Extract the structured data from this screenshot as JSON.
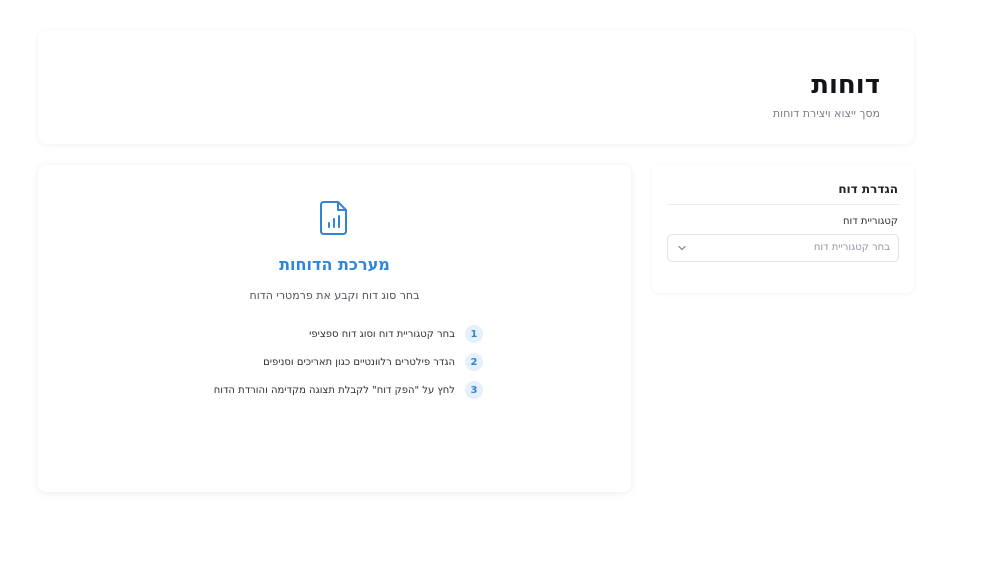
{
  "header": {
    "title": "דוחות",
    "subtitle": "מסך ייצוא ויצירת דוחות"
  },
  "setup": {
    "title": "הגדרת דוח",
    "category_label": "קטגוריית דוח",
    "category_placeholder": "בחר קטגוריית דוח",
    "chevron_icon": "chevron-down-icon"
  },
  "main": {
    "icon": "report-chart-icon",
    "title": "מערכת הדוחות",
    "subtitle": "בחר סוג דוח וקבע את פרמטרי הדוח",
    "steps": [
      {
        "number": "1",
        "text": "בחר קטגוריית דוח וסוג דוח ספציפי"
      },
      {
        "number": "2",
        "text": "הגדר פילטרים רלוונטיים כגון תאריכים וסניפים"
      },
      {
        "number": "3",
        "text": "לחץ על \"הפק דוח\" לקבלת תצוגה מקדימה והורדת הדוח"
      }
    ]
  },
  "colors": {
    "accent": "#2f86d9",
    "step_badge_bg": "#e6f0fb"
  }
}
